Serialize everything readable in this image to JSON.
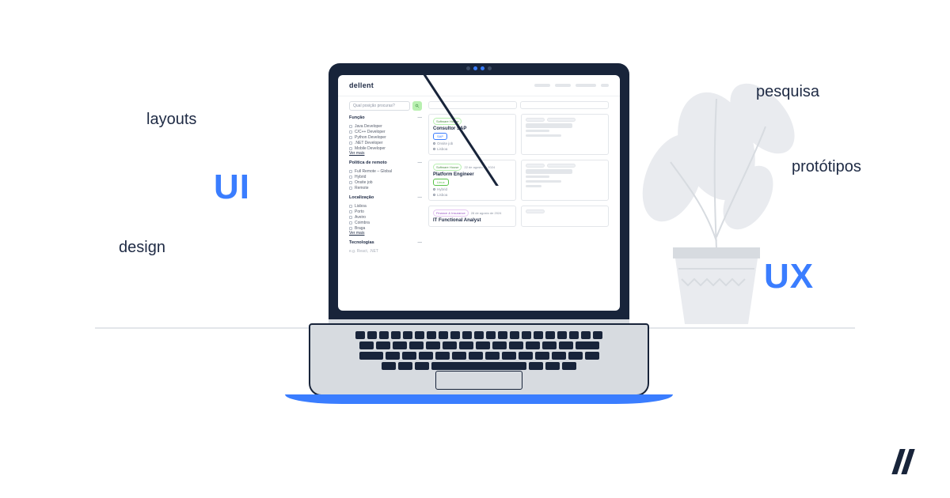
{
  "floating": {
    "layouts": "layouts",
    "design": "design",
    "ui": "UI",
    "pesquisa": "pesquisa",
    "prototipos": "protótipos",
    "ux": "UX"
  },
  "app": {
    "brand": "dellent",
    "search": {
      "placeholder": "Qual posição procuras?"
    },
    "facets": [
      {
        "title": "Função",
        "items": [
          "Java Developer",
          "C/C++ Developer",
          "Python Developer",
          ".NET Developer",
          "Mobile Developer"
        ],
        "more": "Ver mais"
      },
      {
        "title": "Política de remoto",
        "items": [
          "Full Remote – Global",
          "Hybrid",
          "Onsite job",
          "Remote"
        ],
        "more": ""
      },
      {
        "title": "Localização",
        "items": [
          "Lisboa",
          "Porto",
          "Aveiro",
          "Coimbra",
          "Braga"
        ],
        "more": "Ver mais"
      },
      {
        "title": "Tecnologias",
        "items": [
          "e.g. React, .NET"
        ],
        "more": ""
      }
    ],
    "cards": [
      {
        "chip_category": "Software House",
        "chip_date": "",
        "title": "Consultor SAP",
        "badge": "SAP",
        "meta1": "Onsite job",
        "meta2": "Lisboa"
      },
      {
        "chip_category": "Software House",
        "chip_date": "22 de agosto de 2024",
        "title": "Platform Engineer",
        "badge": "Linux",
        "meta1": "Hybrid",
        "meta2": "Lisboa"
      },
      {
        "chip_category": "Finance & Insurance",
        "chip_date": "28 de agosto de 2024",
        "title": "IT Functional Analyst",
        "badge": "",
        "meta1": "",
        "meta2": ""
      }
    ]
  }
}
